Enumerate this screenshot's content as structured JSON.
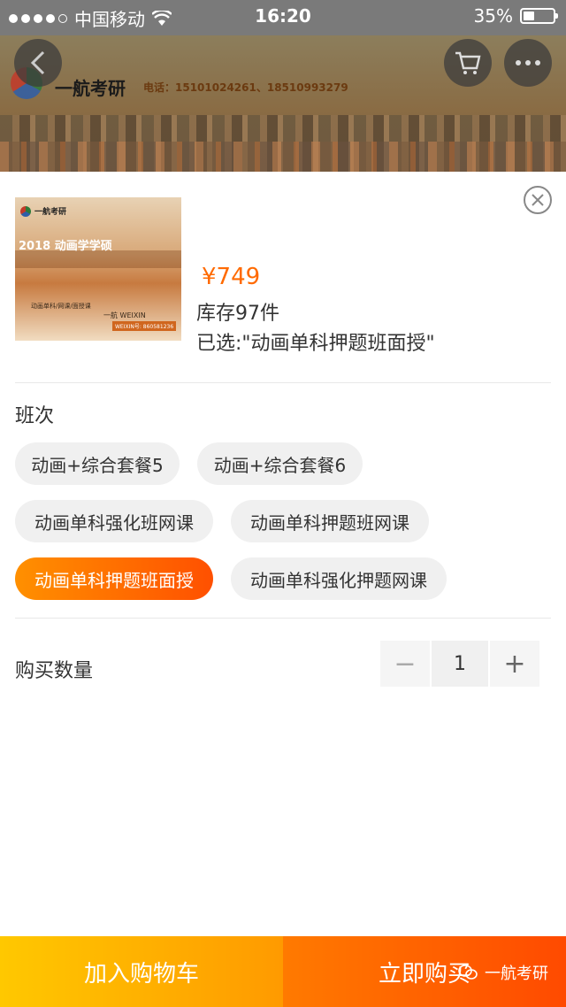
{
  "status_bar": {
    "carrier": "中国移动",
    "time": "16:20",
    "battery": "35%"
  },
  "header": {
    "brand_name": "一航考研",
    "phone_text": "电话：15101024261、18510993279",
    "icons": [
      "back-icon",
      "cart-icon",
      "more-icon"
    ]
  },
  "product": {
    "thumbnail": {
      "brand": "一航考研",
      "title": "2018 动画学学硕",
      "line1": "动画单科/网课/面授课",
      "line2": "一航 WEIXIN",
      "tag": "WEIXIN号: 860581236"
    },
    "price": "¥749",
    "stock": "库存97件",
    "selected": "已选:\"动画单科押题班面授\""
  },
  "options": {
    "label": "班次",
    "items": [
      {
        "label": "动画+综合套餐5",
        "active": false
      },
      {
        "label": "动画+综合套餐6",
        "active": false
      },
      {
        "label": "动画单科强化班网课",
        "active": false
      },
      {
        "label": "动画单科押题班网课",
        "active": false
      },
      {
        "label": "动画单科押题班面授",
        "active": true
      },
      {
        "label": "动画单科强化押题网课",
        "active": false
      }
    ]
  },
  "quantity": {
    "label": "购买数量",
    "minus": "−",
    "value": "1",
    "plus": "+"
  },
  "actions": {
    "add_to_cart": "加入购物车",
    "buy_now": "立即购买"
  },
  "watermark": "一航考研",
  "colors": {
    "accent": "#ff6a00",
    "cart_button": "#ffb400",
    "buy_button": "#ff5a00"
  }
}
